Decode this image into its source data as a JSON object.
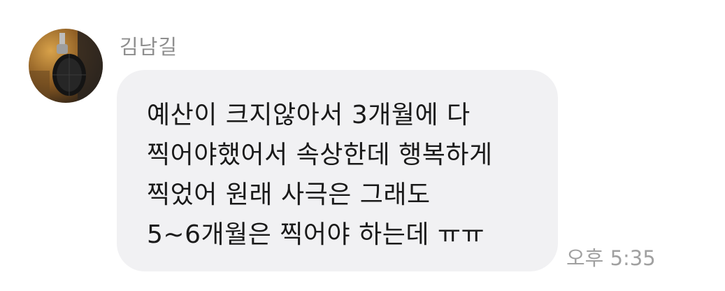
{
  "message": {
    "sender": "김남길",
    "lines": [
      "예산이 크지않아서 3개월에 다",
      "찍어야했어서 속상한데 행복하게",
      "찍었어 원래 사극은 그래도",
      "5~6개월은 찍어야 하는데 ㅠㅠ"
    ],
    "time": "오후 5:35",
    "avatar_icon": "profile-photo-microphone",
    "bubble_color": "#f1f1f3"
  }
}
